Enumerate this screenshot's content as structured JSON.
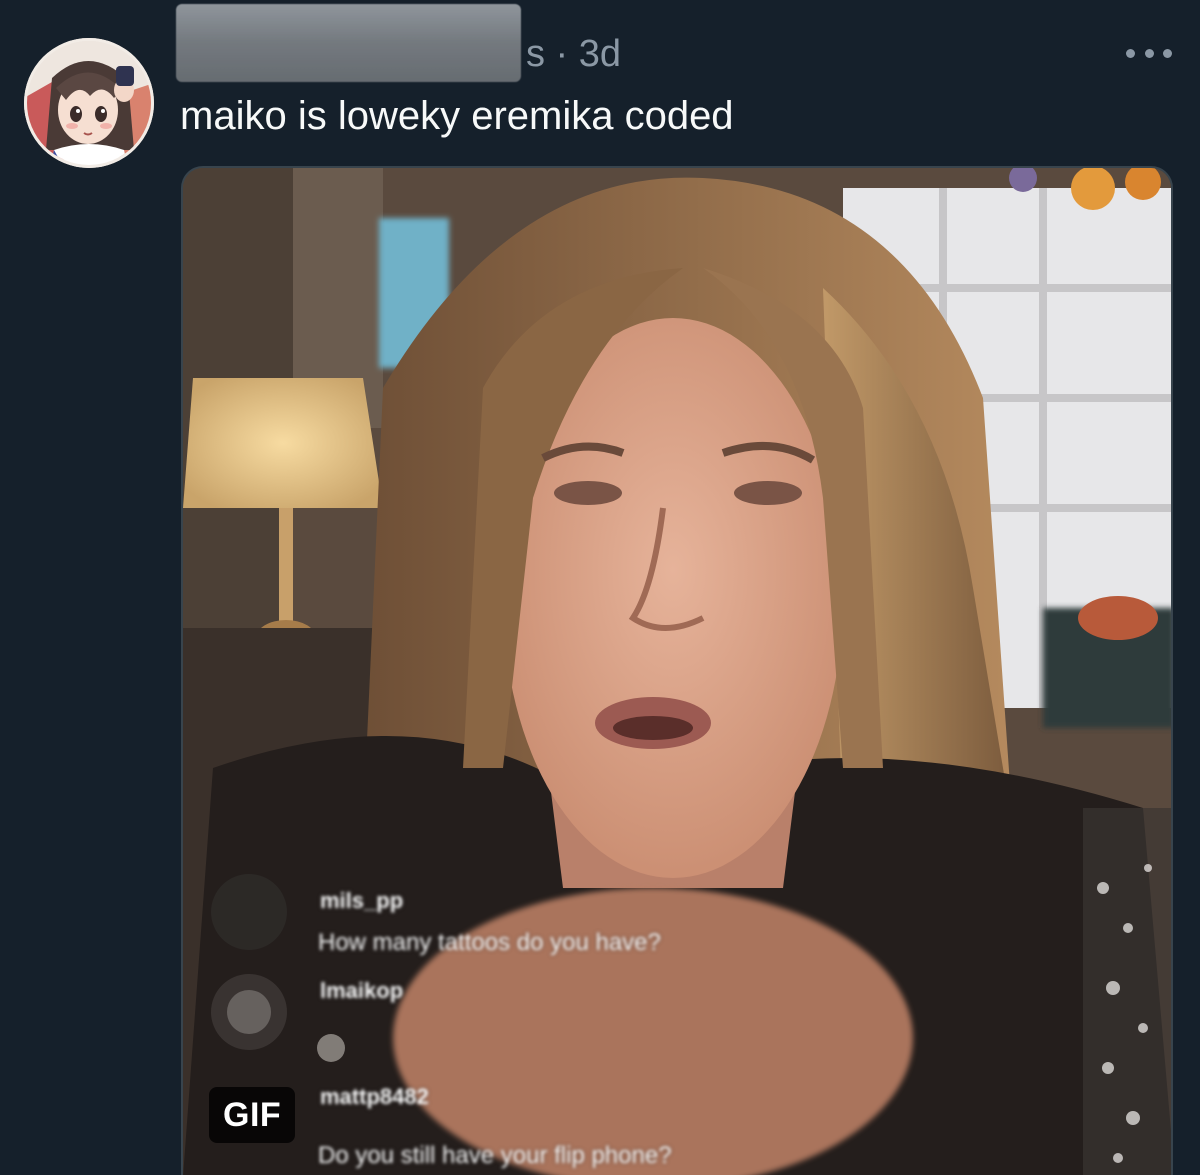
{
  "post": {
    "meta": "s · 3d",
    "text": "maiko is loweky eremika coded",
    "more_icon": "more-horizontal-icon"
  },
  "media": {
    "badge": "GIF",
    "comments": [
      {
        "user": "mils_pp",
        "message": "How many tattoos do you have?"
      },
      {
        "user": "lmaikop",
        "message": ""
      },
      {
        "user": "mattp8482",
        "message": "Do you still have your flip phone?"
      }
    ]
  },
  "colors": {
    "background": "#15202b",
    "secondary_text": "#8b98a5",
    "primary_text": "#f7f9f9",
    "media_border": "#38444d"
  }
}
